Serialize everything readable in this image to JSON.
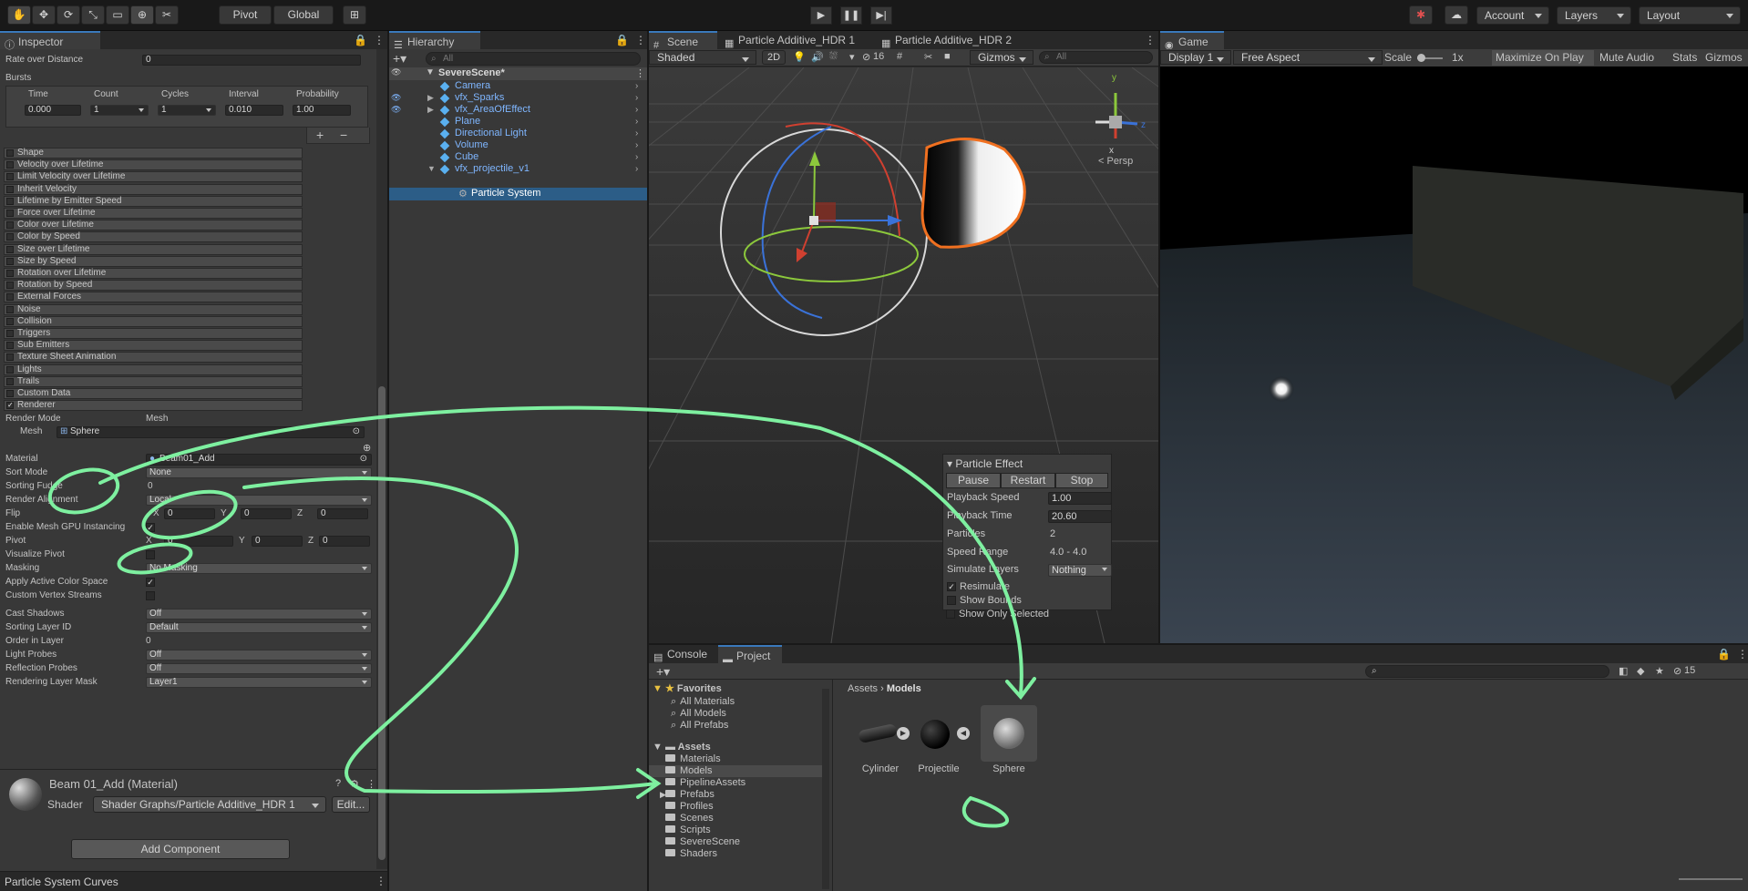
{
  "toolbar": {
    "pivot": "Pivot",
    "global": "Global",
    "account": "Account",
    "layers": "Layers",
    "layout": "Layout"
  },
  "inspector": {
    "tab": "Inspector",
    "rate_over_distance_label": "Rate over Distance",
    "rate_over_distance_value": "0",
    "bursts_label": "Bursts",
    "bursts_headers": [
      "Time",
      "Count",
      "Cycles",
      "Interval",
      "Probability"
    ],
    "burst_row": {
      "time": "0.000",
      "count": "1",
      "cycles": "1",
      "interval": "0.010",
      "probability": "1.00"
    },
    "add_btn": "+",
    "remove_btn": "−",
    "modules": [
      "Shape",
      "Velocity over Lifetime",
      "Limit Velocity over Lifetime",
      "Inherit Velocity",
      "Lifetime by Emitter Speed",
      "Force over Lifetime",
      "Color over Lifetime",
      "Color by Speed",
      "Size over Lifetime",
      "Size by Speed",
      "Rotation over Lifetime",
      "Rotation by Speed",
      "External Forces",
      "Noise",
      "Collision",
      "Triggers",
      "Sub Emitters",
      "Texture Sheet Animation",
      "Lights",
      "Trails",
      "Custom Data",
      "Renderer"
    ],
    "renderer": {
      "render_mode_label": "Render Mode",
      "render_mode_value": "Mesh",
      "mesh_label": "Mesh",
      "mesh_value": "Sphere",
      "material_label": "Material",
      "material_value": "Beam01_Add",
      "sort_mode_label": "Sort Mode",
      "sort_mode_value": "None",
      "sorting_fudge_label": "Sorting Fudge",
      "sorting_fudge_value": "0",
      "render_alignment_label": "Render Alignment",
      "render_alignment_value": "Local",
      "flip_label": "Flip",
      "flip": {
        "x": "0",
        "y": "0",
        "z": "0"
      },
      "gpu_instancing_label": "Enable Mesh GPU Instancing",
      "pivot_label": "Pivot",
      "pivot": {
        "x": "0",
        "y": "0",
        "z": "0"
      },
      "visualize_pivot_label": "Visualize Pivot",
      "masking_label": "Masking",
      "masking_value": "No Masking",
      "apply_color_space_label": "Apply Active Color Space",
      "custom_vertex_label": "Custom Vertex Streams",
      "cast_shadows_label": "Cast Shadows",
      "cast_shadows_value": "Off",
      "sorting_layer_label": "Sorting Layer ID",
      "sorting_layer_value": "Default",
      "order_in_layer_label": "Order in Layer",
      "order_in_layer_value": "0",
      "light_probes_label": "Light Probes",
      "light_probes_value": "Off",
      "reflection_probes_label": "Reflection Probes",
      "reflection_probes_value": "Off",
      "rendering_layer_mask_label": "Rendering Layer Mask",
      "rendering_layer_mask_value": "Layer1"
    },
    "material_header": "Beam 01_Add (Material)",
    "shader_label": "Shader",
    "shader_value": "Shader Graphs/Particle Additive_HDR 1",
    "edit_btn": "Edit...",
    "add_component": "Add Component",
    "curves_label": "Particle System Curves"
  },
  "hierarchy": {
    "tab": "Hierarchy",
    "search_placeholder": "All",
    "scene": "SevereScene*",
    "items": [
      "Camera",
      "vfx_Sparks",
      "vfx_AreaOfEffect",
      "Plane",
      "Directional Light",
      "Volume",
      "Cube",
      "vfx_projectile_v1"
    ],
    "child": "Particle System"
  },
  "scene": {
    "tabs": [
      "Scene",
      "Particle Additive_HDR 1",
      "Particle Additive_HDR 2"
    ],
    "shading": "Shaded",
    "mode_2d": "2D",
    "hidden_count": "16",
    "gizmos": "Gizmos",
    "search_placeholder": "All",
    "axes": {
      "y": "y",
      "z": "z",
      "x": "x"
    },
    "persp": "< Persp"
  },
  "particle_effect": {
    "title": "Particle Effect",
    "pause": "Pause",
    "restart": "Restart",
    "stop": "Stop",
    "playback_speed_label": "Playback Speed",
    "playback_speed_value": "1.00",
    "playback_time_label": "Playback Time",
    "playback_time_value": "20.60",
    "particles_label": "Particles",
    "particles_value": "2",
    "speed_range_label": "Speed Range",
    "speed_range_value": "4.0 - 4.0",
    "simulate_layers_label": "Simulate Layers",
    "simulate_layers_value": "Nothing",
    "resimulate_label": "Resimulate",
    "show_bounds_label": "Show Bounds",
    "show_only_selected_label": "Show Only Selected"
  },
  "game": {
    "tab": "Game",
    "display": "Display 1",
    "aspect": "Free Aspect",
    "scale_label": "Scale",
    "scale_value": "1x",
    "maximize": "Maximize On Play",
    "mute": "Mute Audio",
    "stats": "Stats",
    "gizmos": "Gizmos"
  },
  "project": {
    "tabs": [
      "Console",
      "Project"
    ],
    "hidden_count": "15",
    "favorites_label": "Favorites",
    "favorites": [
      "All Materials",
      "All Models",
      "All Prefabs"
    ],
    "assets_label": "Assets",
    "folders": [
      "Materials",
      "Models",
      "PipelineAssets",
      "Prefabs",
      "Profiles",
      "Scenes",
      "Scripts",
      "SevereScene",
      "Shaders"
    ],
    "breadcrumb": [
      "Assets",
      "Models"
    ],
    "assets": [
      "Cylinder",
      "Projectile",
      "Sphere"
    ]
  }
}
